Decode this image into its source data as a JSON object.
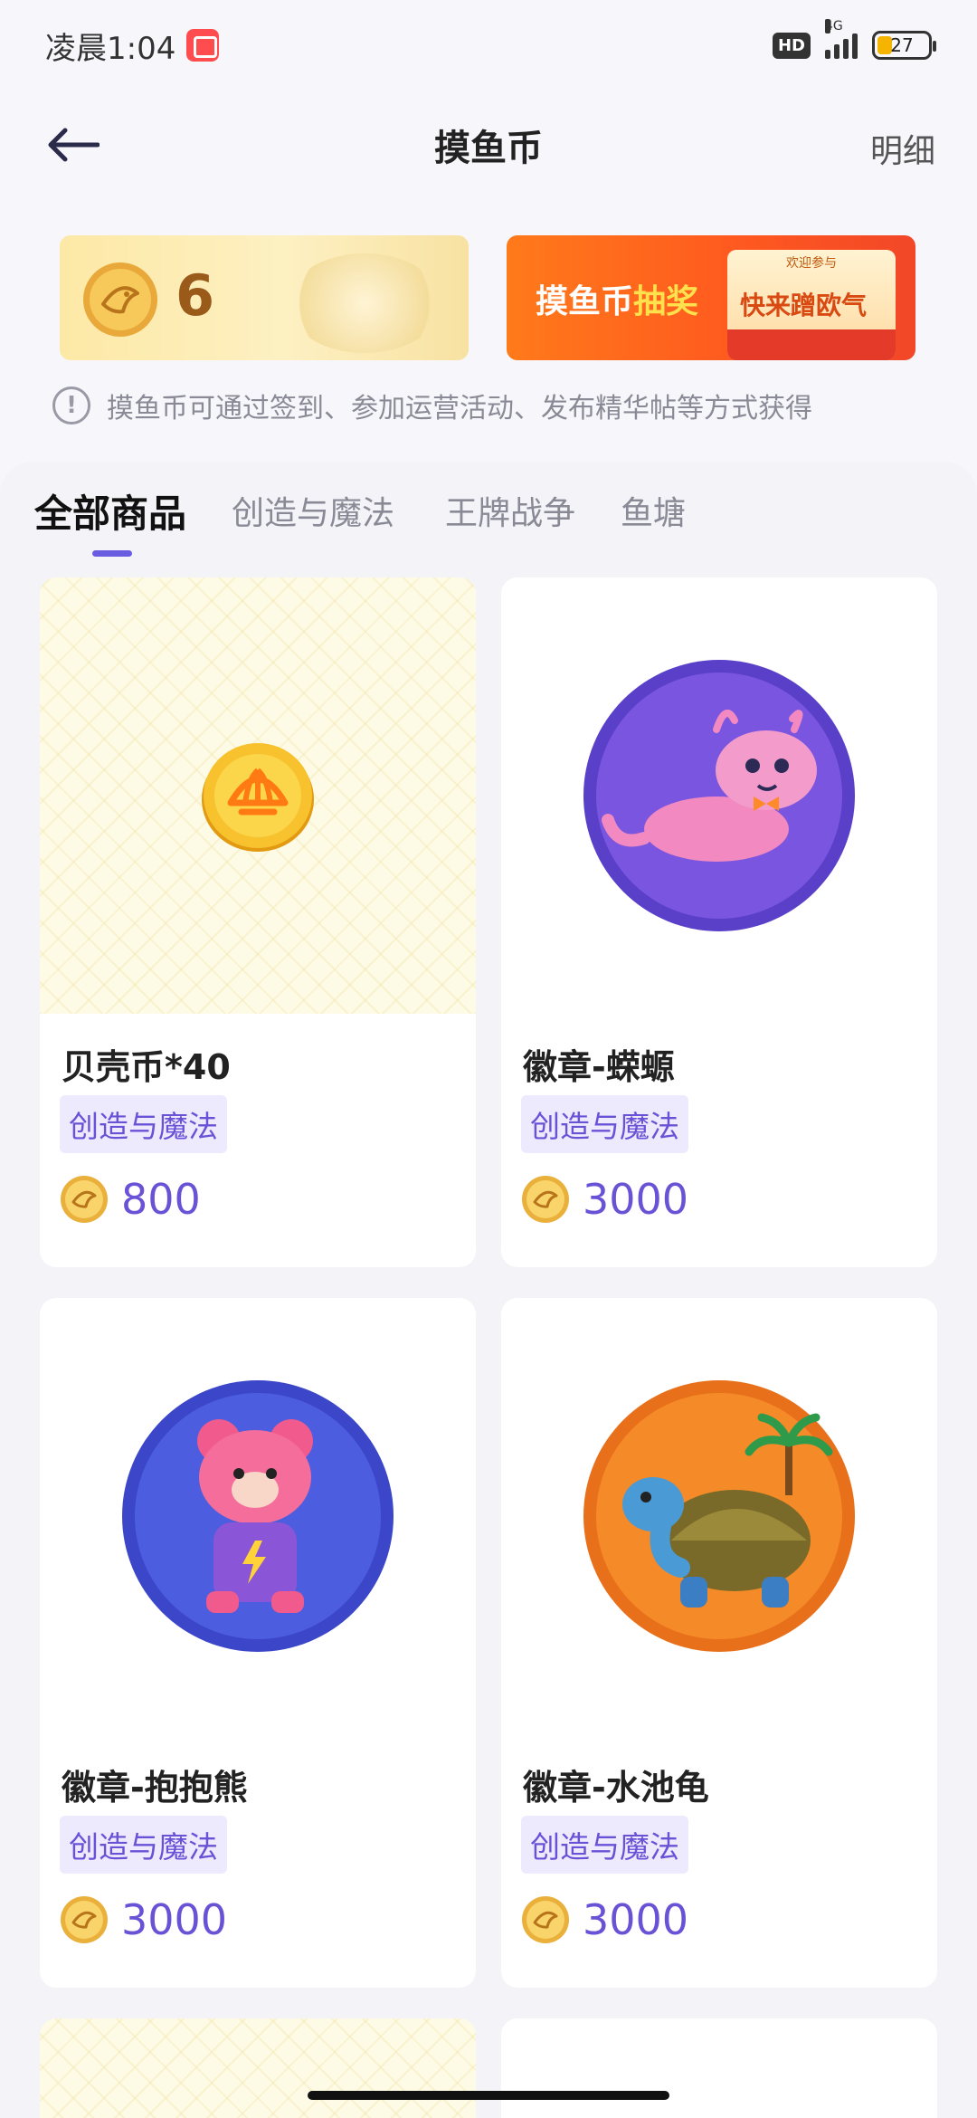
{
  "status_bar": {
    "time": "凌晨1:04",
    "hd": "HD",
    "network": "4G",
    "battery": "27"
  },
  "header": {
    "title": "摸鱼币",
    "detail_label": "明细"
  },
  "balance": {
    "value": "6"
  },
  "lottery": {
    "title_prefix": "摸鱼币",
    "title_highlight": "抽奖",
    "envelope_top": "欢迎参与",
    "slogan": "快来蹭欧气"
  },
  "tip": {
    "text": "摸鱼币可通过签到、参加运营活动、发布精华帖等方式获得"
  },
  "tabs": [
    {
      "label": "全部商品",
      "active": true
    },
    {
      "label": "创造与魔法",
      "active": false
    },
    {
      "label": "王牌战争",
      "active": false
    },
    {
      "label": "鱼塘",
      "active": false
    }
  ],
  "products": [
    {
      "name": "贝壳币*40",
      "tag": "创造与魔法",
      "price": "800",
      "image": "shell-coin-icon"
    },
    {
      "name": "徽章-蝾螈",
      "tag": "创造与魔法",
      "price": "3000",
      "image": "axolotl-badge"
    },
    {
      "name": "徽章-抱抱熊",
      "tag": "创造与魔法",
      "price": "3000",
      "image": "hug-bear-badge"
    },
    {
      "name": "徽章-水池龟",
      "tag": "创造与魔法",
      "price": "3000",
      "image": "pond-turtle-badge"
    }
  ],
  "colors": {
    "accent": "#6a52d6",
    "tag_bg": "#eeeafd",
    "lottery": "#ff5a1f",
    "balance_text": "#9a5a1a"
  }
}
